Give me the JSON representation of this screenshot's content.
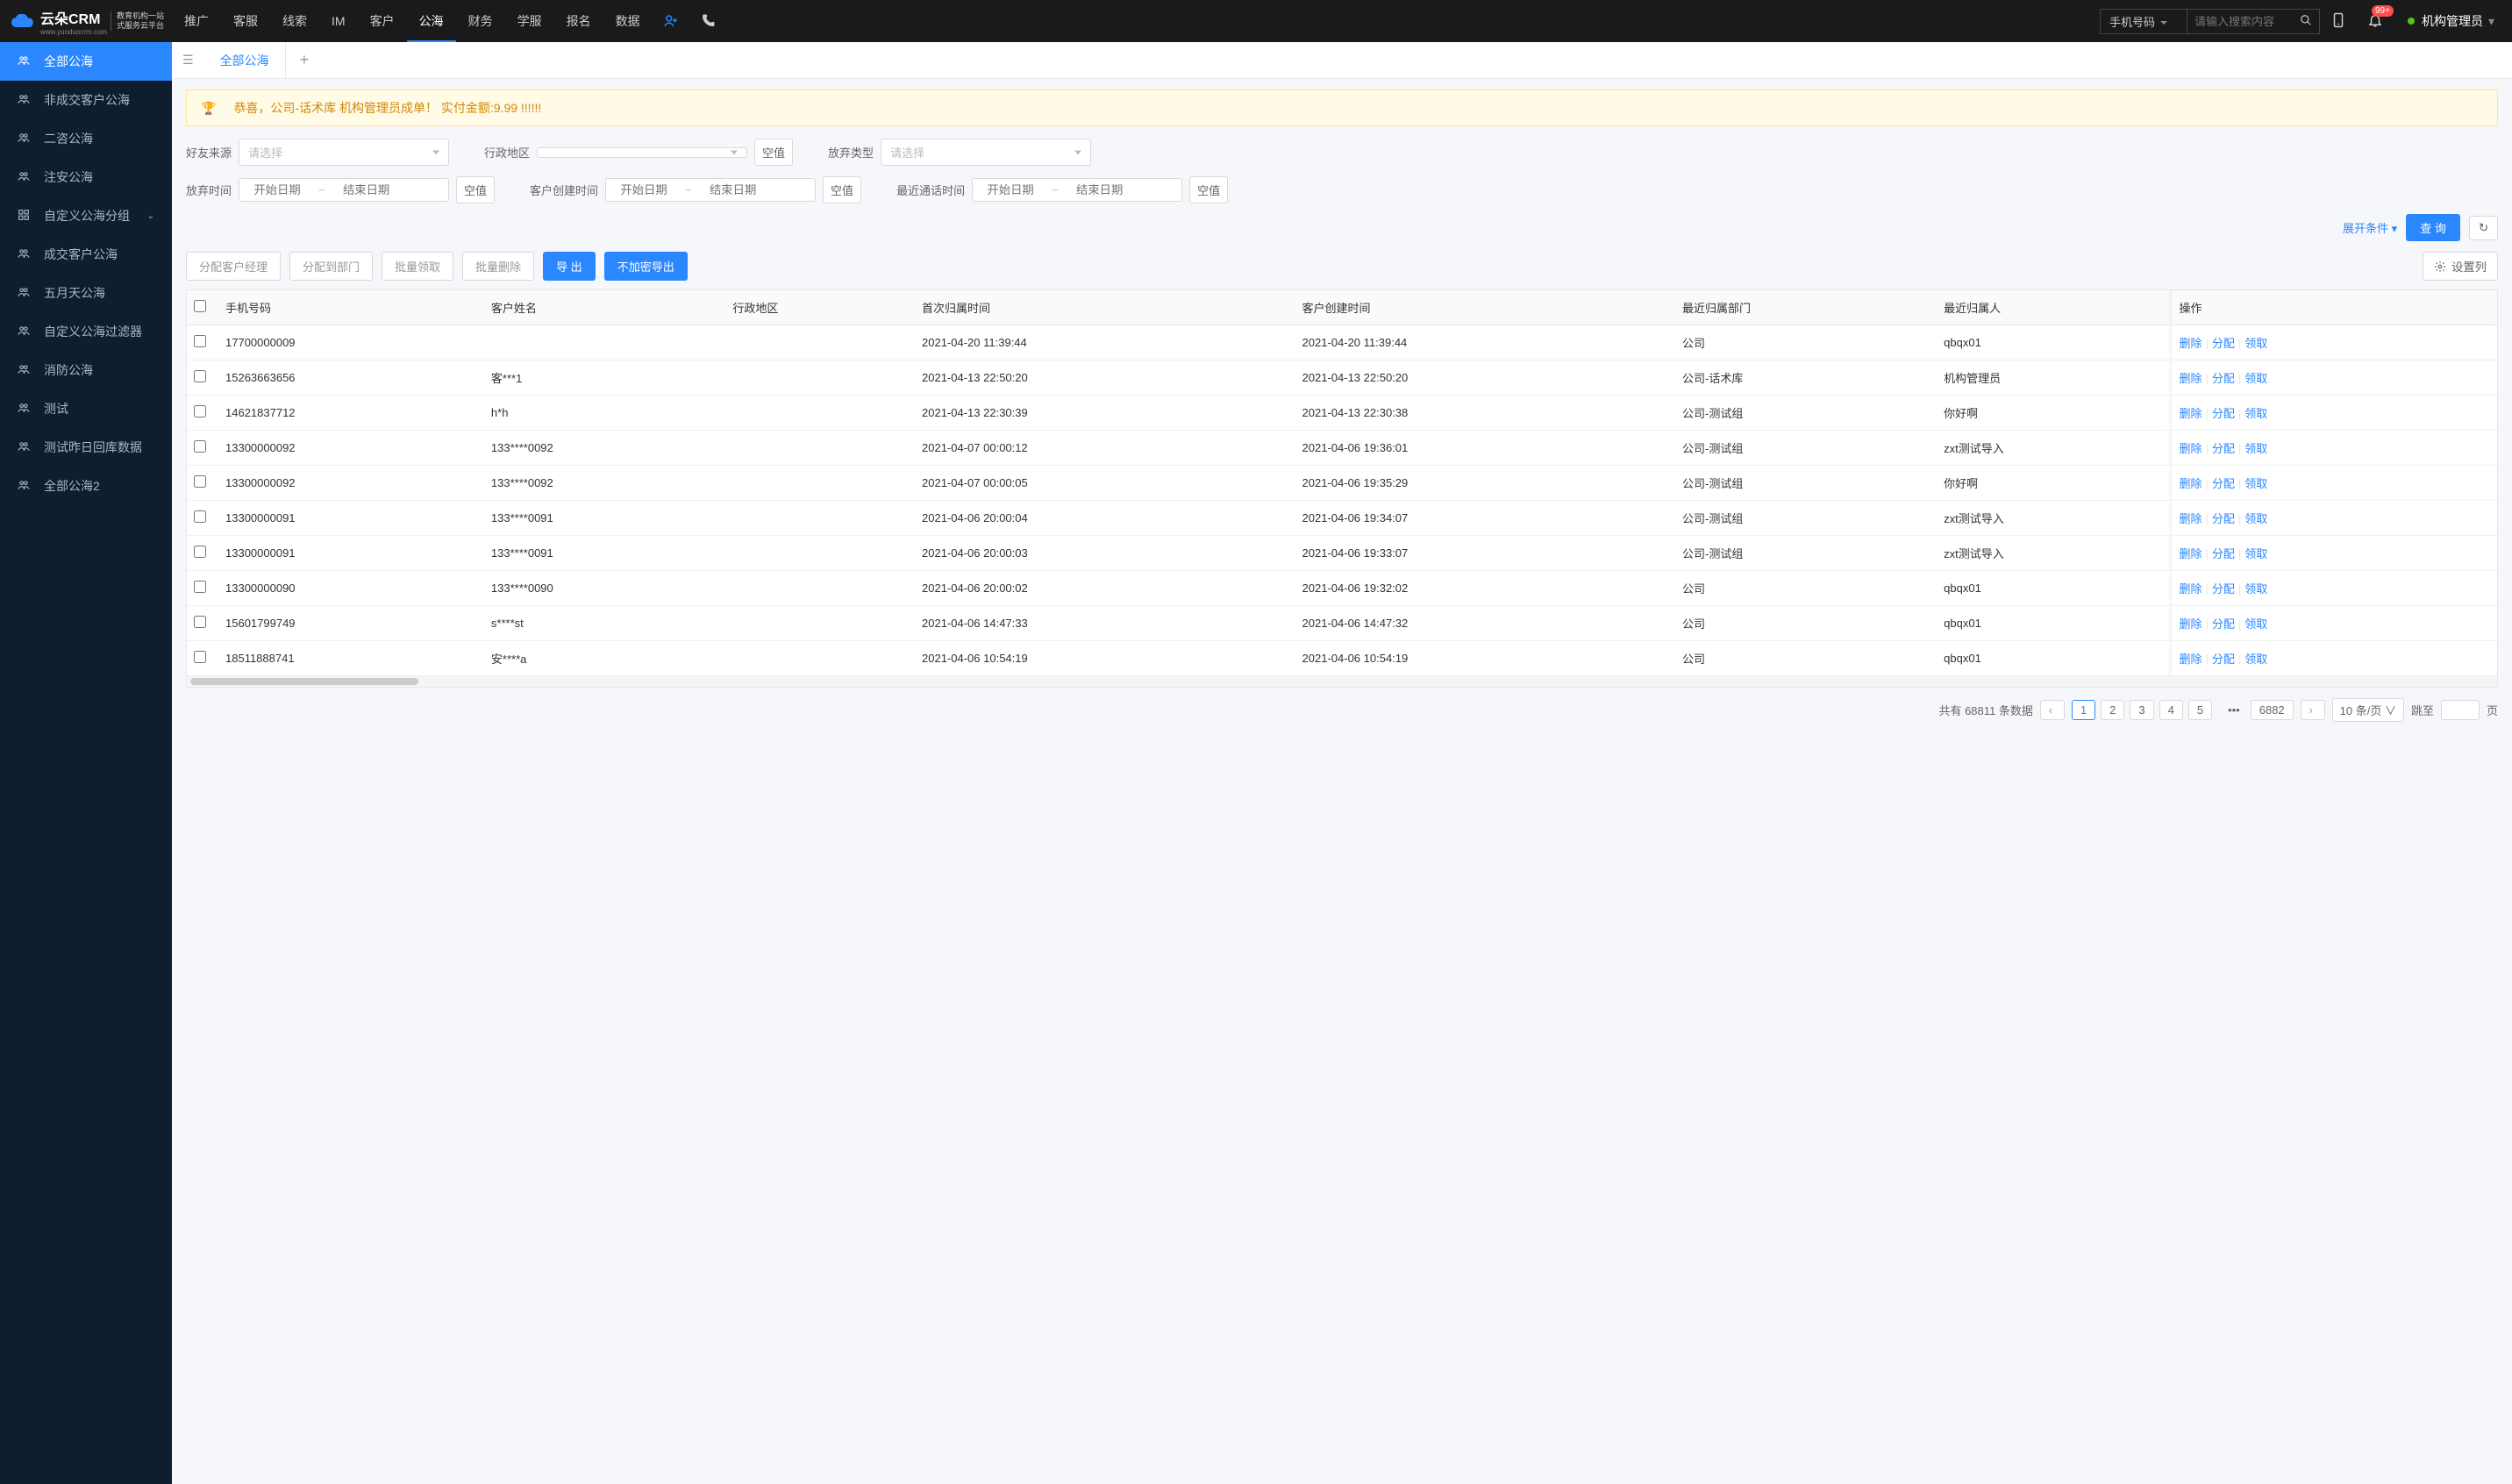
{
  "header": {
    "logo_main": "云朵CRM",
    "logo_sub1": "教育机构一站",
    "logo_sub2": "式服务云平台",
    "logo_url": "www.yunduocrm.com",
    "nav": [
      "推广",
      "客服",
      "线索",
      "IM",
      "客户",
      "公海",
      "财务",
      "学服",
      "报名",
      "数据"
    ],
    "nav_active": 5,
    "search_type": "手机号码",
    "search_placeholder": "请输入搜索内容",
    "notif_badge": "99+",
    "user": "机构管理员"
  },
  "sidebar": {
    "items": [
      {
        "icon": "users",
        "label": "全部公海",
        "active": true
      },
      {
        "icon": "users",
        "label": "非成交客户公海"
      },
      {
        "icon": "users",
        "label": "二咨公海"
      },
      {
        "icon": "users",
        "label": "注安公海"
      },
      {
        "icon": "grid",
        "label": "自定义公海分组",
        "expand": true
      },
      {
        "icon": "users",
        "label": "成交客户公海"
      },
      {
        "icon": "users",
        "label": "五月天公海"
      },
      {
        "icon": "users",
        "label": "自定义公海过滤器"
      },
      {
        "icon": "users",
        "label": "消防公海"
      },
      {
        "icon": "users",
        "label": "测试"
      },
      {
        "icon": "users",
        "label": "测试昨日回库数据"
      },
      {
        "icon": "users",
        "label": "全部公海2"
      }
    ]
  },
  "tabs": {
    "items": [
      "全部公海"
    ],
    "add": "+"
  },
  "alert": "恭喜，公司-话术库  机构管理员成单！  实付金额:9.99 !!!!!!",
  "filters": {
    "friend_source": {
      "label": "好友来源",
      "placeholder": "请选择"
    },
    "region": {
      "label": "行政地区",
      "placeholder": ""
    },
    "abandon_type": {
      "label": "放弃类型",
      "placeholder": "请选择"
    },
    "abandon_time": {
      "label": "放弃时间",
      "start": "开始日期",
      "end": "结束日期"
    },
    "create_time": {
      "label": "客户创建时间",
      "start": "开始日期",
      "end": "结束日期"
    },
    "recent_call": {
      "label": "最近通话时间",
      "start": "开始日期",
      "end": "结束日期"
    },
    "empty_btn": "空值",
    "expand": "展开条件",
    "query": "查 询"
  },
  "toolbar": {
    "assign_manager": "分配客户经理",
    "assign_dept": "分配到部门",
    "batch_claim": "批量领取",
    "batch_delete": "批量删除",
    "export": "导 出",
    "export_plain": "不加密导出",
    "settings": "设置列"
  },
  "table": {
    "columns": [
      "手机号码",
      "客户姓名",
      "行政地区",
      "首次归属时间",
      "客户创建时间",
      "最近归属部门",
      "最近归属人",
      "操作"
    ],
    "ops": {
      "delete": "删除",
      "assign": "分配",
      "claim": "领取"
    },
    "rows": [
      {
        "phone": "17700000009",
        "name": "",
        "region": "",
        "first": "2021-04-20 11:39:44",
        "created": "2021-04-20 11:39:44",
        "dept": "公司",
        "owner": "qbqx01"
      },
      {
        "phone": "15263663656",
        "name": "客***1",
        "region": "",
        "first": "2021-04-13 22:50:20",
        "created": "2021-04-13 22:50:20",
        "dept": "公司-话术库",
        "owner": "机构管理员"
      },
      {
        "phone": "14621837712",
        "name": "h*h",
        "region": "",
        "first": "2021-04-13 22:30:39",
        "created": "2021-04-13 22:30:38",
        "dept": "公司-测试组",
        "owner": "你好啊"
      },
      {
        "phone": "13300000092",
        "name": "133****0092",
        "region": "",
        "first": "2021-04-07 00:00:12",
        "created": "2021-04-06 19:36:01",
        "dept": "公司-测试组",
        "owner": "zxt测试导入"
      },
      {
        "phone": "13300000092",
        "name": "133****0092",
        "region": "",
        "first": "2021-04-07 00:00:05",
        "created": "2021-04-06 19:35:29",
        "dept": "公司-测试组",
        "owner": "你好啊"
      },
      {
        "phone": "13300000091",
        "name": "133****0091",
        "region": "",
        "first": "2021-04-06 20:00:04",
        "created": "2021-04-06 19:34:07",
        "dept": "公司-测试组",
        "owner": "zxt测试导入"
      },
      {
        "phone": "13300000091",
        "name": "133****0091",
        "region": "",
        "first": "2021-04-06 20:00:03",
        "created": "2021-04-06 19:33:07",
        "dept": "公司-测试组",
        "owner": "zxt测试导入"
      },
      {
        "phone": "13300000090",
        "name": "133****0090",
        "region": "",
        "first": "2021-04-06 20:00:02",
        "created": "2021-04-06 19:32:02",
        "dept": "公司",
        "owner": "qbqx01"
      },
      {
        "phone": "15601799749",
        "name": "s****st",
        "region": "",
        "first": "2021-04-06 14:47:33",
        "created": "2021-04-06 14:47:32",
        "dept": "公司",
        "owner": "qbqx01"
      },
      {
        "phone": "18511888741",
        "name": "安****a",
        "region": "",
        "first": "2021-04-06 10:54:19",
        "created": "2021-04-06 10:54:19",
        "dept": "公司",
        "owner": "qbqx01"
      }
    ]
  },
  "pagination": {
    "total_prefix": "共有",
    "total": "68811",
    "total_suffix": "条数据",
    "pages": [
      "1",
      "2",
      "3",
      "4",
      "5"
    ],
    "last": "6882",
    "per_page": "10 条/页",
    "jump_label": "跳至",
    "jump_suffix": "页"
  }
}
